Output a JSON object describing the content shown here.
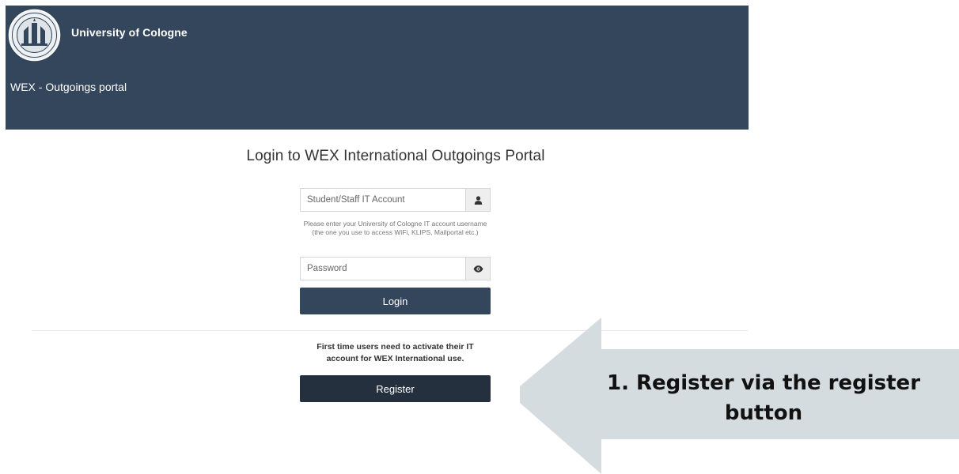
{
  "header": {
    "university": "University of Cologne",
    "portal": "WEX - Outgoings portal"
  },
  "login": {
    "title": "Login to WEX International Outgoings Portal",
    "account_placeholder": "Student/Staff IT Account",
    "account_help": "Please enter your University of Cologne IT account username (the one you use to access WiFi, KLIPS, Mailportal etc.)",
    "password_placeholder": "Password",
    "login_label": "Login"
  },
  "register": {
    "notice": "First time users need to activate their IT account for WEX International use.",
    "register_label": "Register"
  },
  "annotation": {
    "callout_line1": "1. Register via the register",
    "callout_line2": "button"
  },
  "colors": {
    "header_bg": "#34465b",
    "login_button": "#34465b",
    "register_button": "#24303e",
    "arrow_fill": "#d5dce0"
  },
  "icons": {
    "account_addon": "user-icon",
    "password_addon": "eye-icon"
  }
}
